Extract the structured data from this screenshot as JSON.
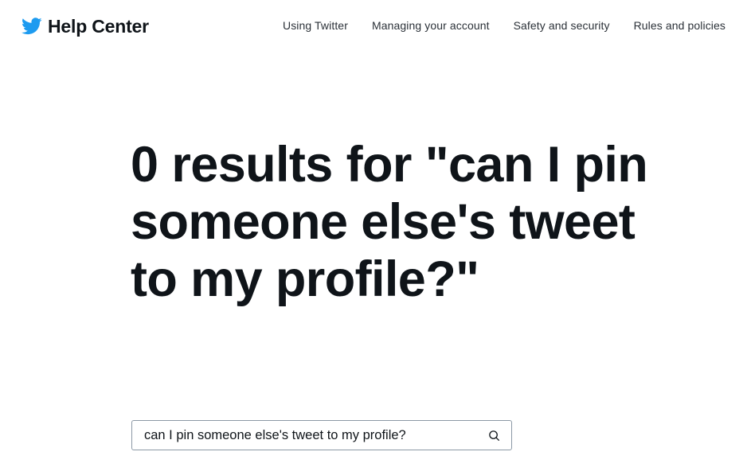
{
  "header": {
    "brand_title": "Help Center",
    "logo_icon": "twitter-bird-icon",
    "brand_color": "#1d9bf0"
  },
  "nav": {
    "items": [
      {
        "label": "Using Twitter"
      },
      {
        "label": "Managing your account"
      },
      {
        "label": "Safety and security"
      },
      {
        "label": "Rules and policies"
      }
    ]
  },
  "main": {
    "results_heading": "0 results for \"can I pin someone else's tweet to my profile?\""
  },
  "search": {
    "value": "can I pin someone else's tweet to my profile?",
    "icon": "search-icon"
  }
}
